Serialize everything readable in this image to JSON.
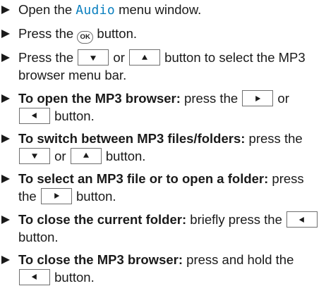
{
  "steps": [
    {
      "pre": "Open the ",
      "display": "Audio",
      "post": " menu window."
    },
    {
      "pre": "Press the ",
      "key": "OK",
      "post": " button."
    },
    {
      "pre": "Press the ",
      "or": " or ",
      "post": " button to select the MP3 browser menu bar."
    },
    {
      "bold": "To open the MP3 browser:",
      "pre": " press the ",
      "or": " or ",
      "post": " button."
    },
    {
      "bold": "To switch between MP3 files/folders:",
      "pre": " press the ",
      "or": " or ",
      "post": " button."
    },
    {
      "bold": "To select an MP3 file or to open a folder:",
      "pre": " press the ",
      "post": " button."
    },
    {
      "bold": "To close the current folder:",
      "pre": " briefly press the ",
      "post": " button."
    },
    {
      "bold": "To close the MP3 browser:",
      "pre": " press and hold the ",
      "post": " button."
    }
  ],
  "icons": {
    "bullet": "bullet-arrow-icon",
    "down": "down-arrow-button-icon",
    "up": "up-arrow-button-icon",
    "right": "right-arrow-button-icon",
    "left": "left-arrow-button-icon",
    "ok": "ok-button-icon"
  },
  "colors": {
    "display_text": "#0a7fbf",
    "text": "#1a1a1a",
    "key_border": "#6f6f6f"
  }
}
